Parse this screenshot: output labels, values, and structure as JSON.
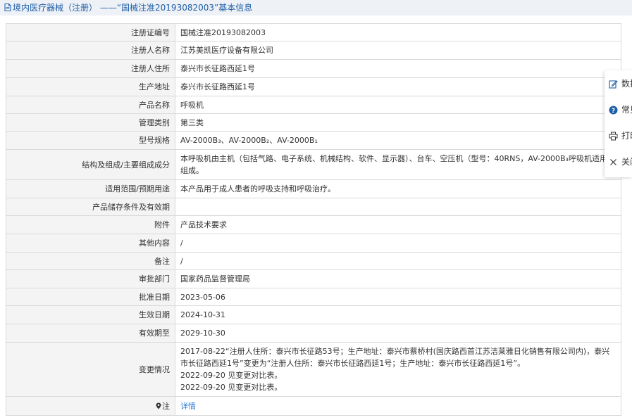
{
  "header": {
    "title": "境内医疗器械（注册） ——“国械注准20193082003”基本信息"
  },
  "rows": [
    {
      "label": "注册证编号",
      "value": "国械注准20193082003"
    },
    {
      "label": "注册人名称",
      "value": "江苏美凯医疗设备有限公司"
    },
    {
      "label": "注册人住所",
      "value": "泰兴市长征路西延1号"
    },
    {
      "label": "生产地址",
      "value": "泰兴市长征路西延1号"
    },
    {
      "label": "产品名称",
      "value": "呼吸机"
    },
    {
      "label": "管理类别",
      "value": "第三类"
    },
    {
      "label": "型号规格",
      "value": "AV-2000B₃、AV-2000B₂、AV-2000B₁"
    },
    {
      "label": "结构及组成/主要组成成分",
      "value": "本呼吸机由主机（包括气路、电子系统、机械结构、软件、显示器）、台车、空压机（型号：40RNS，AV-2000B₃呼吸机适用）组成。"
    },
    {
      "label": "适用范围/预期用途",
      "value": "本产品用于成人患者的呼吸支持和呼吸治疗。"
    },
    {
      "label": "产品储存条件及有效期",
      "value": ""
    },
    {
      "label": "附件",
      "value": "产品技术要求"
    },
    {
      "label": "其他内容",
      "value": "/"
    },
    {
      "label": "备注",
      "value": "/"
    },
    {
      "label": "审批部门",
      "value": "国家药品监督管理局"
    },
    {
      "label": "批准日期",
      "value": "2023-05-06"
    },
    {
      "label": "生效日期",
      "value": "2024-10-31"
    },
    {
      "label": "有效期至",
      "value": "2029-10-30"
    }
  ],
  "change_history": {
    "label": "变更情况",
    "lines": [
      "2017-08-22“注册人住所：泰兴市长征路53号；生产地址：泰兴市蔡桥村(国庆路西首江苏洁莱雅日化销售有限公司内)，泰兴市长征路西延1号”变更为“注册人住所：泰兴市长征路西延1号；生产地址：泰兴市长征路西延1号”。",
      "2022-09-20 见变更对比表。",
      "2022-09-20 见变更对比表。"
    ]
  },
  "note_row": {
    "label": "注",
    "link": "详情"
  },
  "side_panel": {
    "items": [
      {
        "icon": "edit-icon",
        "label": "数据"
      },
      {
        "icon": "help-icon",
        "label": "常见"
      },
      {
        "icon": "print-icon",
        "label": "打印"
      },
      {
        "icon": "close-icon",
        "label": "关闭"
      }
    ]
  },
  "colors": {
    "title_text": "#1f5fa8",
    "title_bg": "#eef1f6",
    "label_bg": "#f4f4f4",
    "border": "#d9d9d9",
    "link": "#2d7bd6"
  }
}
